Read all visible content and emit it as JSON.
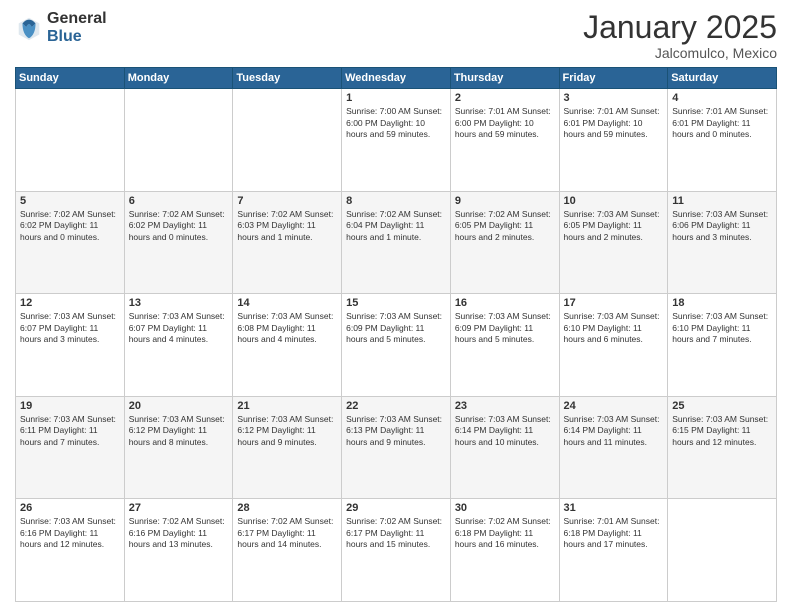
{
  "header": {
    "logo_general": "General",
    "logo_blue": "Blue",
    "month_title": "January 2025",
    "location": "Jalcomulco, Mexico"
  },
  "weekdays": [
    "Sunday",
    "Monday",
    "Tuesday",
    "Wednesday",
    "Thursday",
    "Friday",
    "Saturday"
  ],
  "weeks": [
    [
      {
        "day": "",
        "info": ""
      },
      {
        "day": "",
        "info": ""
      },
      {
        "day": "",
        "info": ""
      },
      {
        "day": "1",
        "info": "Sunrise: 7:00 AM\nSunset: 6:00 PM\nDaylight: 10 hours\nand 59 minutes."
      },
      {
        "day": "2",
        "info": "Sunrise: 7:01 AM\nSunset: 6:00 PM\nDaylight: 10 hours\nand 59 minutes."
      },
      {
        "day": "3",
        "info": "Sunrise: 7:01 AM\nSunset: 6:01 PM\nDaylight: 10 hours\nand 59 minutes."
      },
      {
        "day": "4",
        "info": "Sunrise: 7:01 AM\nSunset: 6:01 PM\nDaylight: 11 hours\nand 0 minutes."
      }
    ],
    [
      {
        "day": "5",
        "info": "Sunrise: 7:02 AM\nSunset: 6:02 PM\nDaylight: 11 hours\nand 0 minutes."
      },
      {
        "day": "6",
        "info": "Sunrise: 7:02 AM\nSunset: 6:02 PM\nDaylight: 11 hours\nand 0 minutes."
      },
      {
        "day": "7",
        "info": "Sunrise: 7:02 AM\nSunset: 6:03 PM\nDaylight: 11 hours\nand 1 minute."
      },
      {
        "day": "8",
        "info": "Sunrise: 7:02 AM\nSunset: 6:04 PM\nDaylight: 11 hours\nand 1 minute."
      },
      {
        "day": "9",
        "info": "Sunrise: 7:02 AM\nSunset: 6:05 PM\nDaylight: 11 hours\nand 2 minutes."
      },
      {
        "day": "10",
        "info": "Sunrise: 7:03 AM\nSunset: 6:05 PM\nDaylight: 11 hours\nand 2 minutes."
      },
      {
        "day": "11",
        "info": "Sunrise: 7:03 AM\nSunset: 6:06 PM\nDaylight: 11 hours\nand 3 minutes."
      }
    ],
    [
      {
        "day": "12",
        "info": "Sunrise: 7:03 AM\nSunset: 6:07 PM\nDaylight: 11 hours\nand 3 minutes."
      },
      {
        "day": "13",
        "info": "Sunrise: 7:03 AM\nSunset: 6:07 PM\nDaylight: 11 hours\nand 4 minutes."
      },
      {
        "day": "14",
        "info": "Sunrise: 7:03 AM\nSunset: 6:08 PM\nDaylight: 11 hours\nand 4 minutes."
      },
      {
        "day": "15",
        "info": "Sunrise: 7:03 AM\nSunset: 6:09 PM\nDaylight: 11 hours\nand 5 minutes."
      },
      {
        "day": "16",
        "info": "Sunrise: 7:03 AM\nSunset: 6:09 PM\nDaylight: 11 hours\nand 5 minutes."
      },
      {
        "day": "17",
        "info": "Sunrise: 7:03 AM\nSunset: 6:10 PM\nDaylight: 11 hours\nand 6 minutes."
      },
      {
        "day": "18",
        "info": "Sunrise: 7:03 AM\nSunset: 6:10 PM\nDaylight: 11 hours\nand 7 minutes."
      }
    ],
    [
      {
        "day": "19",
        "info": "Sunrise: 7:03 AM\nSunset: 6:11 PM\nDaylight: 11 hours\nand 7 minutes."
      },
      {
        "day": "20",
        "info": "Sunrise: 7:03 AM\nSunset: 6:12 PM\nDaylight: 11 hours\nand 8 minutes."
      },
      {
        "day": "21",
        "info": "Sunrise: 7:03 AM\nSunset: 6:12 PM\nDaylight: 11 hours\nand 9 minutes."
      },
      {
        "day": "22",
        "info": "Sunrise: 7:03 AM\nSunset: 6:13 PM\nDaylight: 11 hours\nand 9 minutes."
      },
      {
        "day": "23",
        "info": "Sunrise: 7:03 AM\nSunset: 6:14 PM\nDaylight: 11 hours\nand 10 minutes."
      },
      {
        "day": "24",
        "info": "Sunrise: 7:03 AM\nSunset: 6:14 PM\nDaylight: 11 hours\nand 11 minutes."
      },
      {
        "day": "25",
        "info": "Sunrise: 7:03 AM\nSunset: 6:15 PM\nDaylight: 11 hours\nand 12 minutes."
      }
    ],
    [
      {
        "day": "26",
        "info": "Sunrise: 7:03 AM\nSunset: 6:16 PM\nDaylight: 11 hours\nand 12 minutes."
      },
      {
        "day": "27",
        "info": "Sunrise: 7:02 AM\nSunset: 6:16 PM\nDaylight: 11 hours\nand 13 minutes."
      },
      {
        "day": "28",
        "info": "Sunrise: 7:02 AM\nSunset: 6:17 PM\nDaylight: 11 hours\nand 14 minutes."
      },
      {
        "day": "29",
        "info": "Sunrise: 7:02 AM\nSunset: 6:17 PM\nDaylight: 11 hours\nand 15 minutes."
      },
      {
        "day": "30",
        "info": "Sunrise: 7:02 AM\nSunset: 6:18 PM\nDaylight: 11 hours\nand 16 minutes."
      },
      {
        "day": "31",
        "info": "Sunrise: 7:01 AM\nSunset: 6:18 PM\nDaylight: 11 hours\nand 17 minutes."
      },
      {
        "day": "",
        "info": ""
      }
    ]
  ]
}
